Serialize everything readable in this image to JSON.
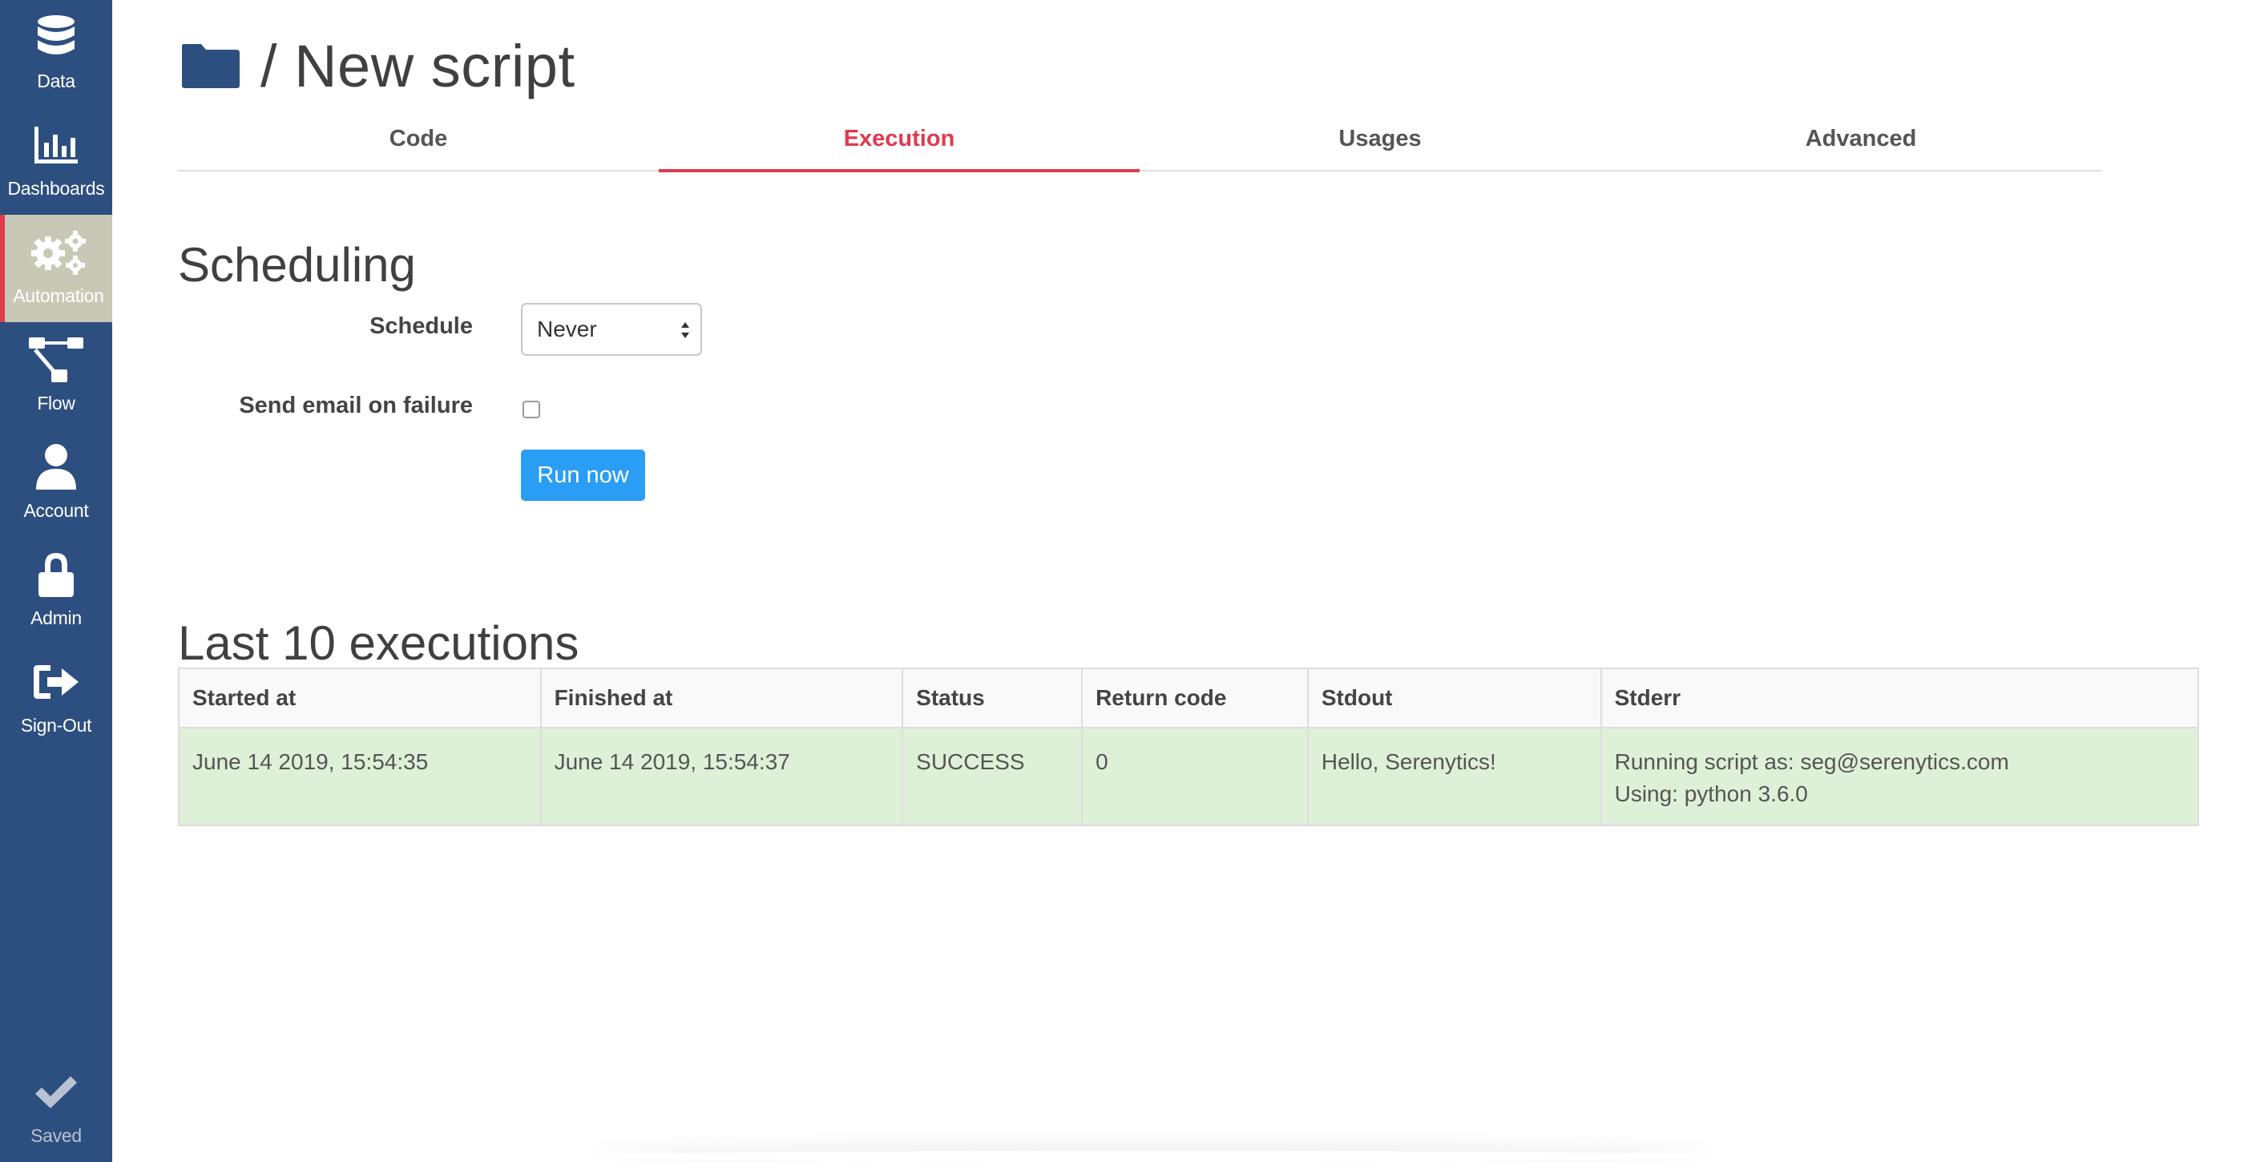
{
  "sidebar": {
    "items": [
      {
        "label": "Data",
        "icon": "database-icon"
      },
      {
        "label": "Dashboards",
        "icon": "bar-chart-icon"
      },
      {
        "label": "Automation",
        "icon": "gears-icon",
        "active": true
      },
      {
        "label": "Flow",
        "icon": "flow-icon"
      },
      {
        "label": "Account",
        "icon": "user-icon"
      },
      {
        "label": "Admin",
        "icon": "lock-icon"
      },
      {
        "label": "Sign-Out",
        "icon": "sign-out-icon"
      }
    ],
    "saved_label": "Saved"
  },
  "header": {
    "title": "/ New script"
  },
  "tabs": [
    {
      "label": "Code"
    },
    {
      "label": "Execution",
      "active": true
    },
    {
      "label": "Usages"
    },
    {
      "label": "Advanced"
    }
  ],
  "scheduling": {
    "title": "Scheduling",
    "schedule_label": "Schedule",
    "schedule_value": "Never",
    "email_label": "Send email on failure",
    "email_checked": false,
    "run_label": "Run now"
  },
  "executions": {
    "title": "Last 10 executions",
    "columns": [
      "Started at",
      "Finished at",
      "Status",
      "Return code",
      "Stdout",
      "Stderr"
    ],
    "rows": [
      {
        "started_at": "June 14 2019, 15:54:35",
        "finished_at": "June 14 2019, 15:54:37",
        "status": "SUCCESS",
        "return_code": "0",
        "stdout": "Hello, Serenytics!",
        "stderr": [
          "Running script as: seg@serenytics.com",
          "Using: python 3.6.0"
        ]
      }
    ]
  },
  "colors": {
    "sidebar": "#2d4f7f",
    "active_nav": "#c9c8b6",
    "accent": "#e03a4e",
    "button": "#2a9df4",
    "success_row": "#dff0d8"
  }
}
